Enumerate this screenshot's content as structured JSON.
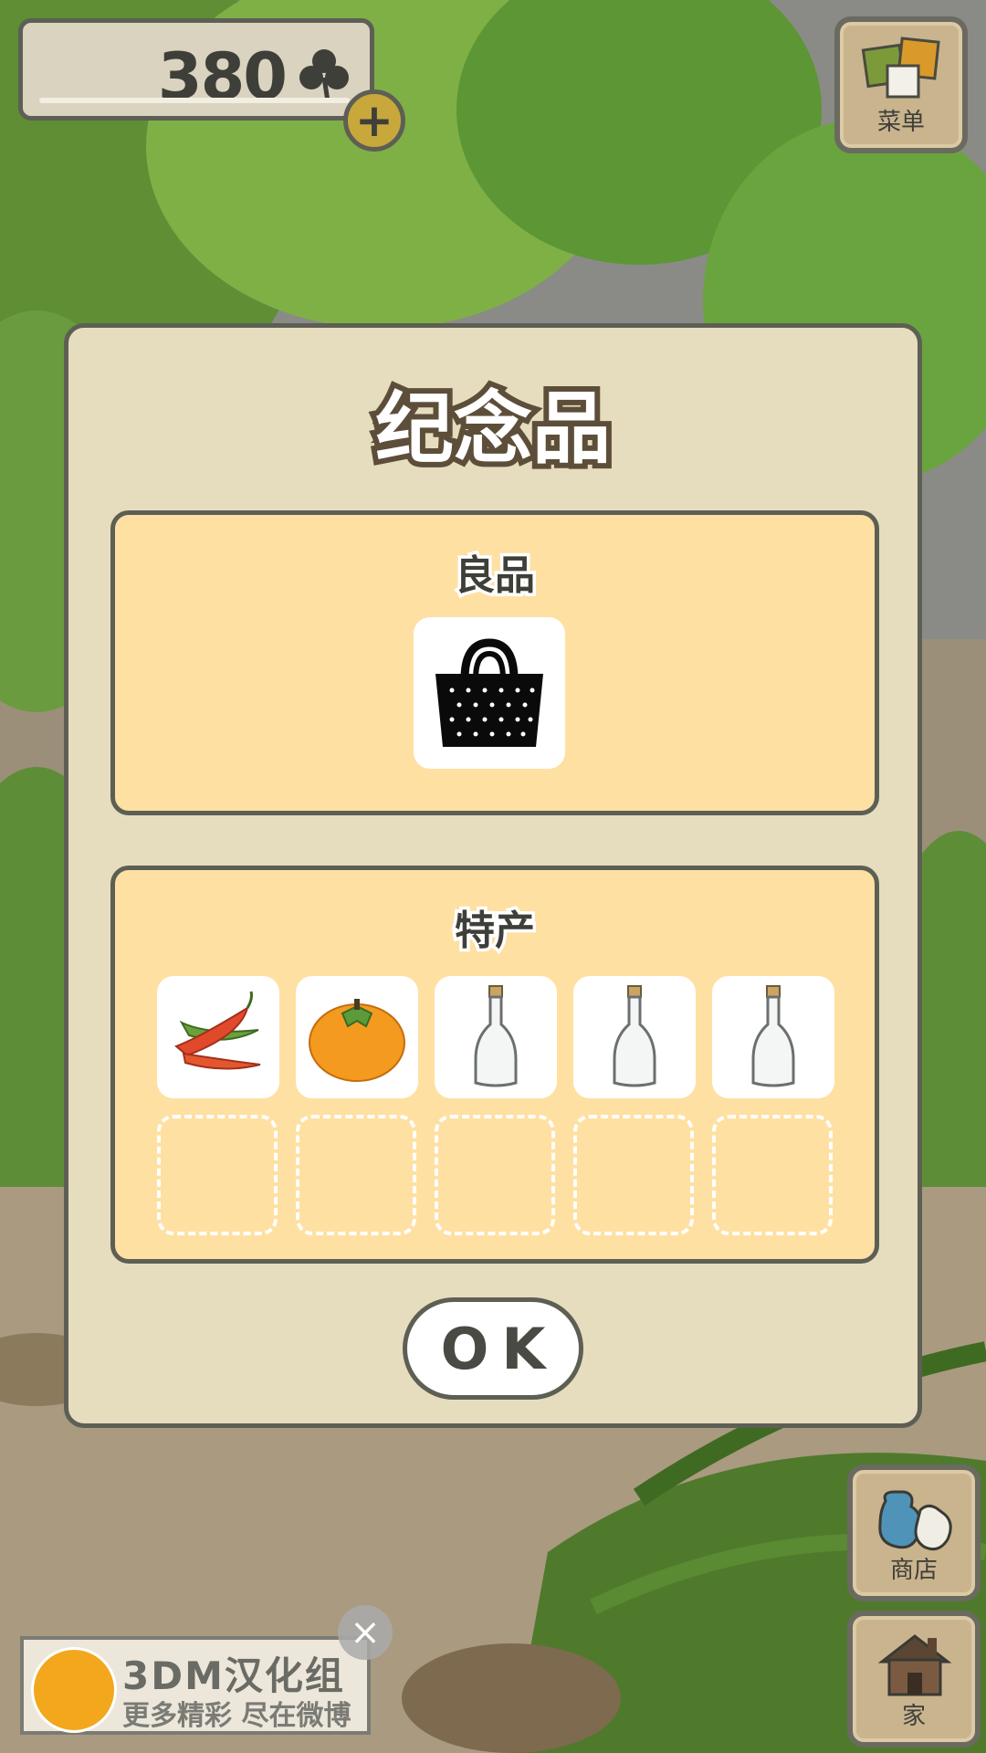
{
  "hud": {
    "clover_count": "380",
    "add_label": "+"
  },
  "side_buttons": {
    "menu_label": "菜单",
    "shop_label": "商店",
    "home_label": "家"
  },
  "dialog": {
    "title": "纪念品",
    "good_items": {
      "title": "良品",
      "items": [
        "basket-icon"
      ]
    },
    "specialties": {
      "title": "特产",
      "items": [
        "chili-pepper-icon",
        "persimmon-icon",
        "bottle-icon",
        "bottle-icon",
        "bottle-icon"
      ],
      "empty_slots": 5
    },
    "ok_label": "OK"
  },
  "ad": {
    "title": "3DM汉化组",
    "subtitle": "更多精彩 尽在微博",
    "close_label": "×"
  },
  "colors": {
    "dialog_bg": "#e6ddbf",
    "panel_bg": "#ffe0a3",
    "outline": "#5d5f55",
    "foliage": "#6fa23c"
  }
}
